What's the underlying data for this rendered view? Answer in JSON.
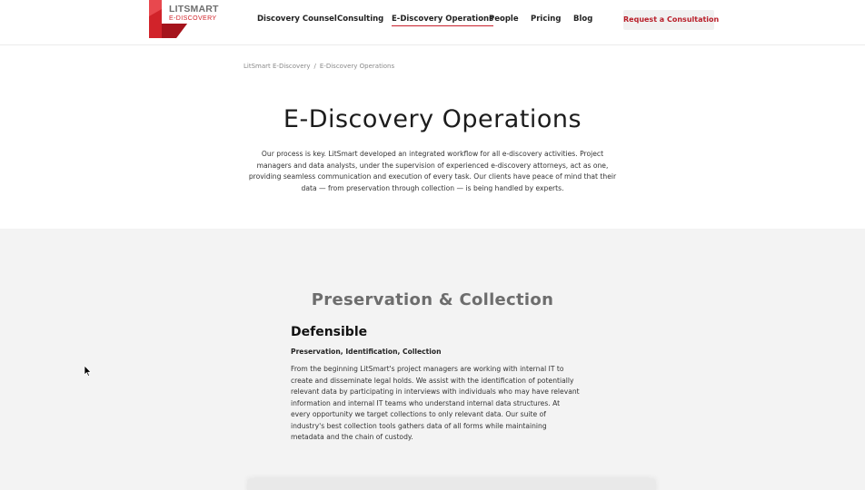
{
  "logo": {
    "brand_line1": "LITSMART",
    "brand_line2": "E-DISCOVERY",
    "icon": "litsmart-logo-mark",
    "brand_color": "#d1232a"
  },
  "nav": {
    "items": [
      {
        "label": "Discovery Counsel",
        "active": false
      },
      {
        "label": "Consulting",
        "active": false
      },
      {
        "label": "E-Discovery Operations",
        "active": true
      },
      {
        "label": "People",
        "active": false
      },
      {
        "label": "Pricing",
        "active": false
      },
      {
        "label": "Blog",
        "active": false
      }
    ],
    "cta_label": "Request a Consultation",
    "accent_color": "#c8202c"
  },
  "breadcrumb": {
    "root": "LitSmart E-Discovery",
    "separator": "/",
    "current": "E-Discovery Operations"
  },
  "page": {
    "title": "E-Discovery Operations",
    "intro": "Our process is key. LitSmart developed an integrated workflow for all e-discovery activities. Project managers and data analysts, under the supervision of experienced e-discovery attorneys, act as one, providing seamless communication and execution of every task. Our clients have peace of mind that their data — from preservation through collection — is being handled by experts."
  },
  "section": {
    "heading": "Preservation & Collection",
    "subheading": "Defensible",
    "tagline": "Preservation, Identification, Collection",
    "body": "From the beginning LitSmart's project managers are working with internal IT to create and disseminate legal holds. We assist with the identification of potentially relevant data by participating in interviews with individuals who may have relevant information and internal IT teams who understand internal data structures. At every opportunity we target collections to only relevant data. Our suite of industry's best collection tools gathers data of all forms while maintaining metadata and the chain of custody.",
    "background": "#f3f3f3"
  }
}
